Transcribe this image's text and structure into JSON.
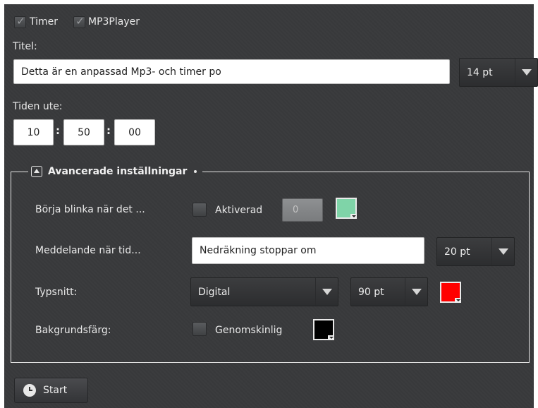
{
  "toggles": {
    "timer": {
      "label": "Timer",
      "checked": true
    },
    "mp3player": {
      "label": "MP3Player",
      "checked": true
    }
  },
  "title_section": {
    "label": "Titel:",
    "value": "Detta är en anpassad Mp3- och timer po",
    "font_size": "14 pt"
  },
  "time_section": {
    "label": "Tiden ute:",
    "hours": "10",
    "minutes": "50",
    "seconds": "00",
    "separator": ":"
  },
  "advanced": {
    "title": "Avancerade inställningar",
    "expanded": true,
    "blink": {
      "label": "Börja blinka när det ...",
      "checkbox_label": "Aktiverad",
      "checked": false,
      "value": "0",
      "color": "#7fd4a8"
    },
    "message": {
      "label": "Meddelande när tid...",
      "value": "Nedräkning stoppar om",
      "font_size": "20 pt"
    },
    "font": {
      "label": "Typsnitt:",
      "family": "Digital",
      "size": "90 pt",
      "color": "#ff0000"
    },
    "background": {
      "label": "Bakgrundsfärg:",
      "checkbox_label": "Genomskinlig",
      "checked": false,
      "color": "#000000"
    }
  },
  "start_button": {
    "label": "Start",
    "icon": "clock-icon"
  }
}
